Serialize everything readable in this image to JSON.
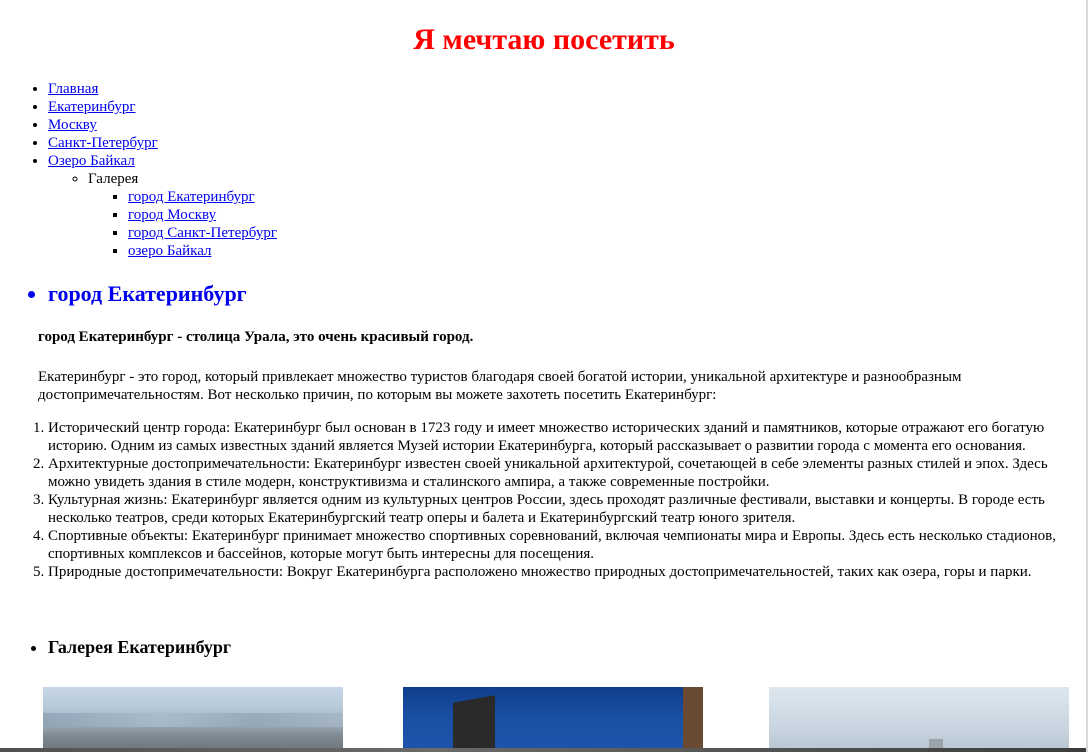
{
  "page": {
    "title": "Я мечтаю посетить"
  },
  "nav": {
    "items": [
      {
        "label": "Главная"
      },
      {
        "label": "Екатеринбург"
      },
      {
        "label": "Москву"
      },
      {
        "label": "Санкт-Петербург"
      },
      {
        "label": "Озеро Байкал"
      }
    ],
    "gallery": {
      "label": "Галерея",
      "items": [
        {
          "label": "город Екатеринбург"
        },
        {
          "label": "город Москву"
        },
        {
          "label": "город Санкт-Петербург"
        },
        {
          "label": "озеро Байкал"
        }
      ]
    }
  },
  "section": {
    "heading": "город Екатеринбург",
    "lead": "город Екатеринбург - столица Урала, это очень красивый город.",
    "intro": "Екатеринбург - это город, который привлекает множество туристов благодаря своей богатой истории, уникальной архитектуре и разнообразным достопримечательностям. Вот несколько причин, по которым вы можете захотеть посетить Екатеринбург:",
    "reasons": [
      "Исторический центр города: Екатеринбург был основан в 1723 году и имеет множество исторических зданий и памятников, которые отражают его богатую историю. Одним из самых известных зданий является Музей истории Екатеринбурга, который рассказывает о развитии города с момента его основания.",
      "Архитектурные достопримечательности: Екатеринбург известен своей уникальной архитектурой, сочетающей в себе элементы разных стилей и эпох. Здесь можно увидеть здания в стиле модерн, конструктивизма и сталинского ампира, а также современные постройки.",
      "Культурная жизнь: Екатеринбург является одним из культурных центров России, здесь проходят различные фестивали, выставки и концерты. В городе есть несколько театров, среди которых Екатеринбургский театр оперы и балета и Екатеринбургский театр юного зрителя.",
      "Спортивные объекты: Екатеринбург принимает множество спортивных соревнований, включая чемпионаты мира и Европы. Здесь есть несколько стадионов, спортивных комплексов и бассейнов, которые могут быть интересны для посещения.",
      "Природные достопримечательности: Вокруг Екатеринбурга расположено множество природных достопримечательностей, таких как озера, горы и парки."
    ],
    "gallery_heading": "Галерея Екатеринбург"
  },
  "colors": {
    "title": "#ff0000",
    "link": "#0000ee"
  }
}
